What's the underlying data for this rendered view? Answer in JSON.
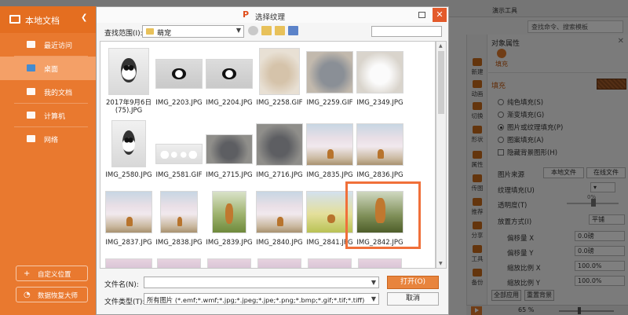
{
  "background": {
    "menu_item": "演示工具",
    "search_placeholder": "查找命令、搜索模板",
    "props_title": "对象属性",
    "fill_tab": "填充",
    "fill_section": "填充",
    "fill_options": [
      "纯色填充(S)",
      "渐变填充(G)",
      "图片或纹理填充(P)",
      "图案填充(A)"
    ],
    "selected_fill_option": 2,
    "hide_bg_graphics": "隐藏背景图形(H)",
    "image_source_label": "图片来源",
    "local_file_button": "本地文件",
    "online_file_button": "在线文件",
    "texture_fill_label": "纹理填充(U)",
    "transparency_label": "透明度(T)",
    "transparency_value": "0%",
    "placement_label": "放置方式(I)",
    "placement_value": "平铺",
    "offset_x_label": "偏移量 X",
    "offset_x_value": "0.0磅",
    "offset_y_label": "偏移量 Y",
    "offset_y_value": "0.0磅",
    "scale_x_label": "缩放比例 X",
    "scale_x_value": "100.0%",
    "scale_y_label": "缩放比例 Y",
    "scale_y_value": "100.0%",
    "apply_all_button": "全部应用",
    "reset_button": "重置背景",
    "side_strip": [
      "新建",
      "动画",
      "切换",
      "形状",
      "属性",
      "传图",
      "推荐",
      "分享",
      "工具",
      "备份"
    ],
    "zoom": "65 %"
  },
  "left_panel": {
    "title": "本地文档",
    "items": [
      {
        "label": "最近访问"
      },
      {
        "label": "桌面"
      },
      {
        "label": "我的文档"
      },
      {
        "label": "计算机"
      },
      {
        "label": "网络"
      }
    ],
    "selected_index": 1,
    "custom_location_button": "自定义位置",
    "data_recovery_button": "数据恢复大师"
  },
  "dialog": {
    "title": "选择纹理",
    "look_in_label": "查找范围(I):",
    "look_in_value": "萌宠",
    "files": [
      {
        "name": "2017年9月6日(75).JPG"
      },
      {
        "name": "IMG_2203.JPG"
      },
      {
        "name": "IMG_2204.JPG"
      },
      {
        "name": "IMG_2258.GIF"
      },
      {
        "name": "IMG_2259.GIF"
      },
      {
        "name": "IMG_2349.JPG"
      },
      {
        "name": "IMG_2580.JPG"
      },
      {
        "name": "IMG_2581.GIF"
      },
      {
        "name": "IMG_2715.JPG"
      },
      {
        "name": "IMG_2716.JPG"
      },
      {
        "name": "IMG_2835.JPG"
      },
      {
        "name": "IMG_2836.JPG"
      },
      {
        "name": "IMG_2837.JPG"
      },
      {
        "name": "IMG_2838.JPG"
      },
      {
        "name": "IMG_2839.JPG"
      },
      {
        "name": "IMG_2840.JPG"
      },
      {
        "name": "IMG_2841.JPG"
      },
      {
        "name": "IMG_2842.JPG"
      }
    ],
    "highlighted_file": "IMG_2842.JPG",
    "filename_label": "文件名(N):",
    "filename_value": "",
    "filetype_label": "文件类型(T):",
    "filetype_value": "所有图片 (*.emf;*.wmf;*.jpg;*.jpeg;*.jpe;*.png;*.bmp;*.gif;*.tif;*.tiff)",
    "open_button": "打开(O)",
    "cancel_button": "取消"
  },
  "colors": {
    "accent": "#e9792f",
    "highlight_box": "#f0703a",
    "close_button": "#e35a2b"
  }
}
